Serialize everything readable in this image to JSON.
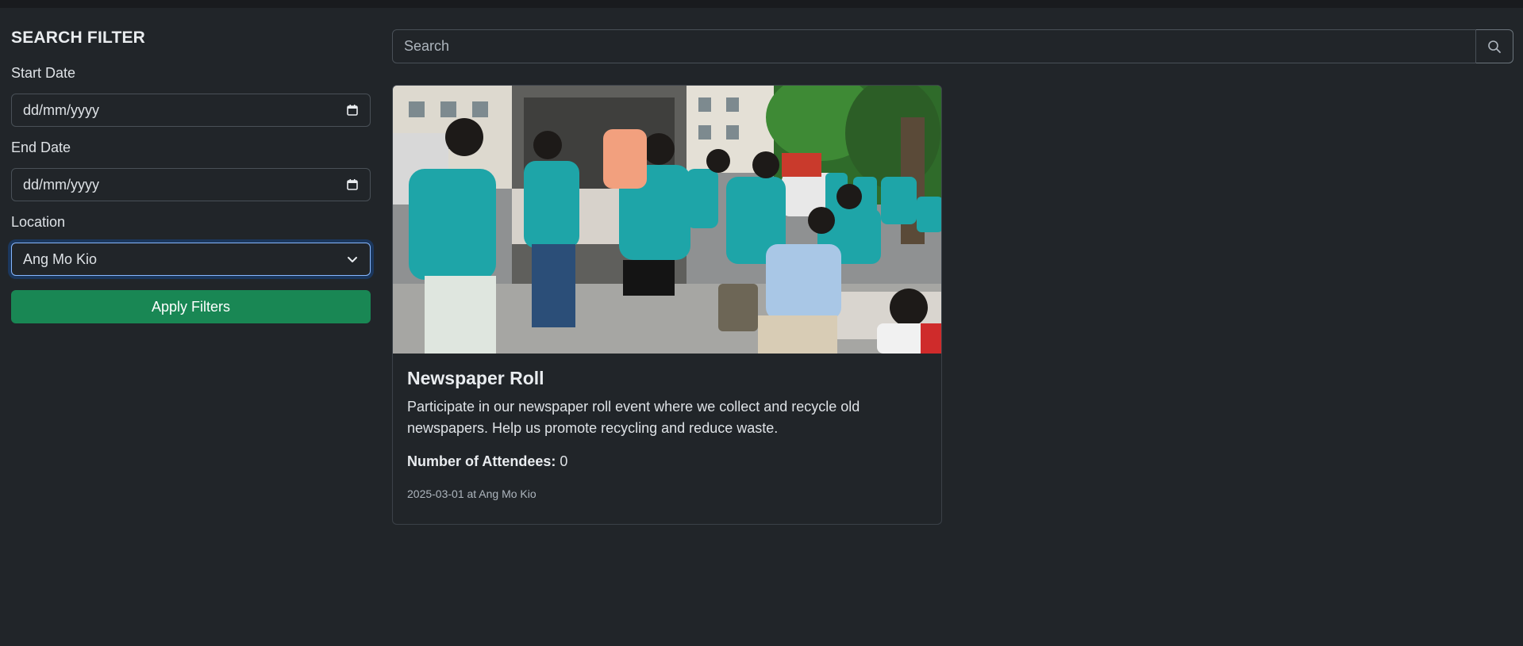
{
  "sidebar": {
    "title": "SEARCH FILTER",
    "start_date": {
      "label": "Start Date",
      "value": "dd/mm/yyyy"
    },
    "end_date": {
      "label": "End Date",
      "value": "dd/mm/yyyy"
    },
    "location": {
      "label": "Location",
      "value": "Ang Mo Kio"
    },
    "apply_label": "Apply Filters"
  },
  "search": {
    "placeholder": "Search"
  },
  "events": [
    {
      "title": "Newspaper Roll",
      "description": "Participate in our newspaper roll event where we collect and recycle old newspapers. Help us promote recycling and reduce waste.",
      "attendees_label": "Number of Attendees:",
      "attendees_count": "0",
      "meta": "2025-03-01 at Ang Mo Kio"
    }
  ],
  "colors": {
    "background": "#212529",
    "primary_button": "#198754",
    "volunteer_shirt": "#1ea5a8",
    "focus_ring": "#86b7fe"
  },
  "icons": [
    "calendar-icon",
    "chevron-down-icon",
    "search-icon"
  ]
}
